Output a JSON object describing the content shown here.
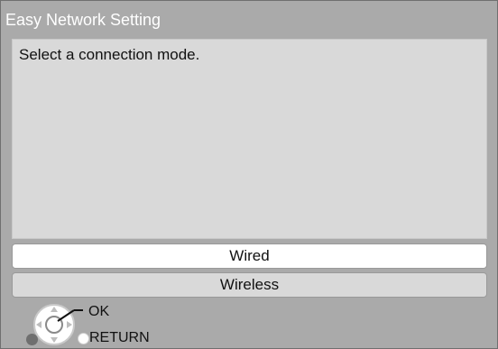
{
  "window": {
    "title": "Easy Network Setting"
  },
  "message": {
    "text": "Select a connection mode."
  },
  "options": [
    {
      "label": "Wired",
      "selected": true
    },
    {
      "label": "Wireless",
      "selected": false
    }
  ],
  "controls": {
    "ok_label": "OK",
    "return_label": "RETURN"
  },
  "colors": {
    "background": "#aaaaaa",
    "panel": "#d9d9d9",
    "selected_option": "#ffffff",
    "title_text": "#ffffff"
  },
  "icons": {
    "navigation": "dpad-icon",
    "select": "ok-button-icon",
    "back": "return-circle-icon",
    "side": "side-dot-icon"
  }
}
